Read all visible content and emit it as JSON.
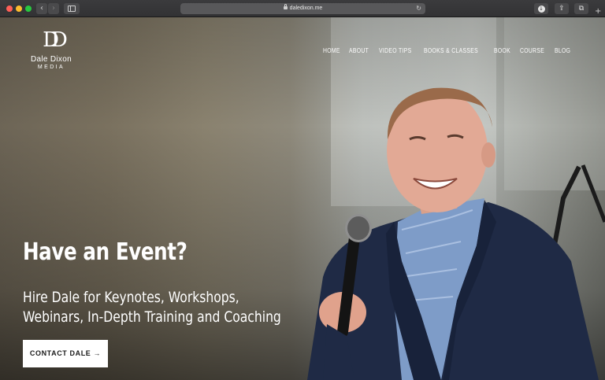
{
  "browser": {
    "url": "daledixon.me"
  },
  "site": {
    "logo_mark": "DD",
    "logo_name": "Dale Dixon",
    "logo_sub": "MEDIA",
    "nav": [
      {
        "label": "HOME"
      },
      {
        "label": "ABOUT"
      },
      {
        "label": "VIDEO TIPS"
      },
      {
        "label": "BOOKS & CLASSES"
      },
      {
        "label": "BOOK"
      },
      {
        "label": "COURSE"
      },
      {
        "label": "BLOG"
      }
    ]
  },
  "hero": {
    "headline": "Have an Event?",
    "subline_1": "Hire Dale for Keynotes, Workshops,",
    "subline_2": "Webinars, In-Depth Training and Coaching",
    "cta_label": "CONTACT DALE →"
  },
  "colors": {
    "chrome": "#323234",
    "cta_background": "#ffffff",
    "text_on_hero": "#ffffff"
  }
}
